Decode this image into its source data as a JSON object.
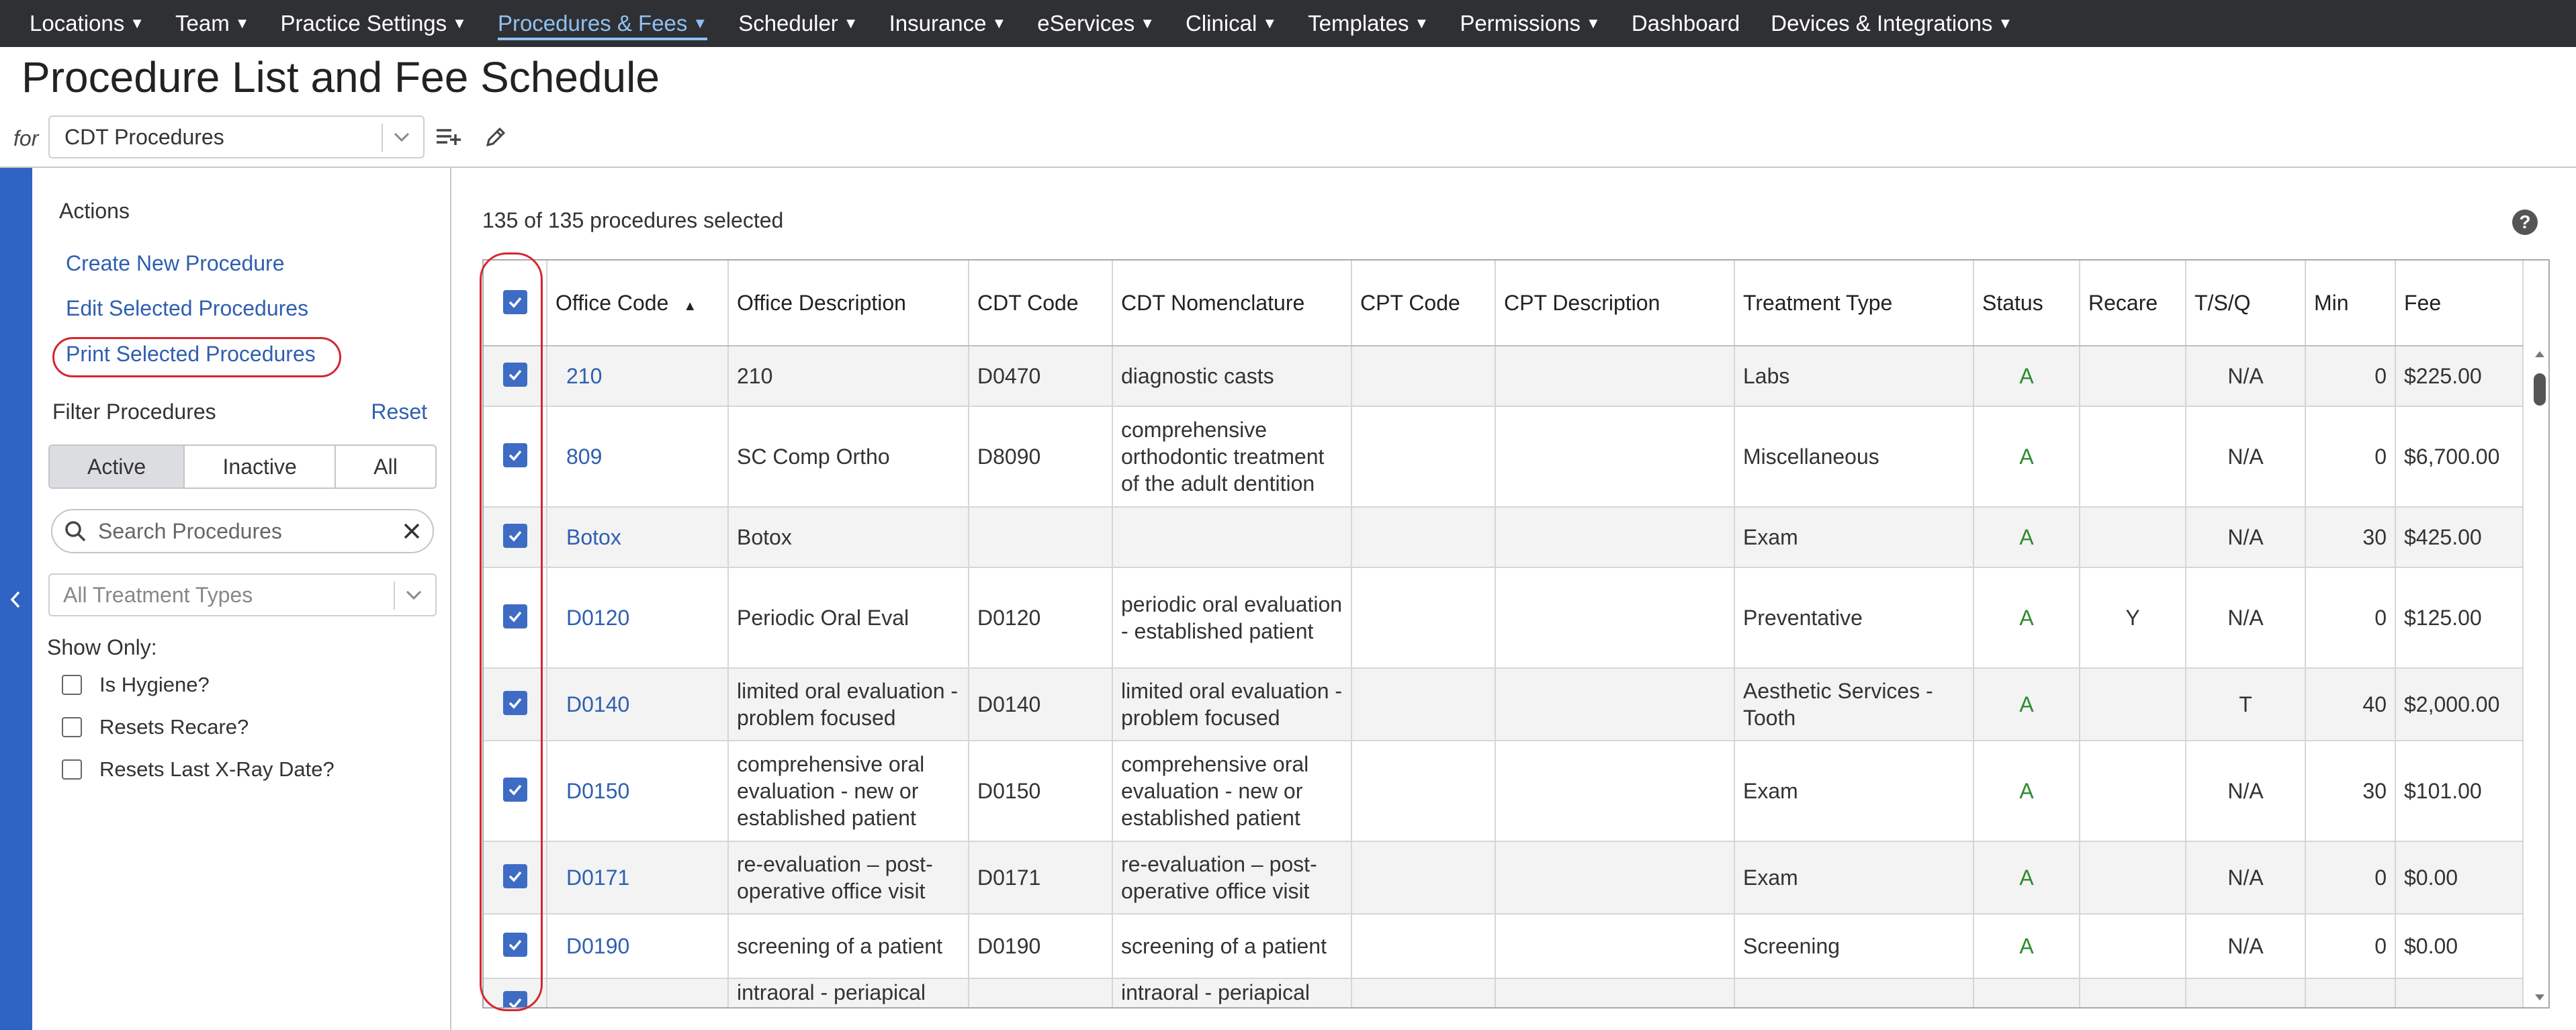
{
  "nav": {
    "items": [
      {
        "label": "Locations",
        "caret": true
      },
      {
        "label": "Team",
        "caret": true
      },
      {
        "label": "Practice Settings",
        "caret": true
      },
      {
        "label": "Procedures & Fees",
        "caret": true,
        "active": true
      },
      {
        "label": "Scheduler",
        "caret": true
      },
      {
        "label": "Insurance",
        "caret": true
      },
      {
        "label": "eServices",
        "caret": true
      },
      {
        "label": "Clinical",
        "caret": true
      },
      {
        "label": "Templates",
        "caret": true
      },
      {
        "label": "Permissions",
        "caret": true
      },
      {
        "label": "Dashboard",
        "caret": false
      },
      {
        "label": "Devices & Integrations",
        "caret": true
      }
    ]
  },
  "header": {
    "title": "Procedure List and Fee Schedule",
    "for_label": "for",
    "schedule_value": "CDT Procedures"
  },
  "sidebar": {
    "actions_heading": "Actions",
    "create_link": "Create New Procedure",
    "edit_link": "Edit Selected Procedures",
    "print_link": "Print Selected Procedures",
    "filter_heading": "Filter Procedures",
    "reset_link": "Reset",
    "status_filter": {
      "active": "Active",
      "inactive": "Inactive",
      "all": "All",
      "selected": "Active"
    },
    "search_placeholder": "Search Procedures",
    "treatment_type_placeholder": "All Treatment Types",
    "show_only_label": "Show Only:",
    "checkboxes": [
      "Is Hygiene?",
      "Resets Recare?",
      "Resets Last X-Ray Date?"
    ]
  },
  "main": {
    "selected_count_text": "135 of 135 procedures selected",
    "help_glyph": "?",
    "columns": [
      "Office Code",
      "Office Description",
      "CDT Code",
      "CDT Nomenclature",
      "CPT Code",
      "CPT Description",
      "Treatment Type",
      "Status",
      "Recare",
      "T/S/Q",
      "Min",
      "Fee"
    ],
    "rows": [
      {
        "code": "210",
        "desc": "210",
        "cdt": "D0470",
        "nom": "diagnostic casts",
        "cpt": "",
        "cpt_desc": "",
        "type": "Labs",
        "status": "A",
        "recare": "",
        "tsq": "N/A",
        "min": "0",
        "fee": "$225.00"
      },
      {
        "code": "809",
        "desc": "SC Comp Ortho",
        "cdt": "D8090",
        "nom": "comprehensive orthodontic treatment of the adult dentition",
        "cpt": "",
        "cpt_desc": "",
        "type": "Miscellaneous",
        "status": "A",
        "recare": "",
        "tsq": "N/A",
        "min": "0",
        "fee": "$6,700.00"
      },
      {
        "code": "Botox",
        "desc": "Botox",
        "cdt": "",
        "nom": "",
        "cpt": "",
        "cpt_desc": "",
        "type": "Exam",
        "status": "A",
        "recare": "",
        "tsq": "N/A",
        "min": "30",
        "fee": "$425.00"
      },
      {
        "code": "D0120",
        "desc": "Periodic Oral Eval",
        "cdt": "D0120",
        "nom": "periodic oral evaluation - established patient",
        "cpt": "",
        "cpt_desc": "",
        "type": "Preventative",
        "status": "A",
        "recare": "Y",
        "tsq": "N/A",
        "min": "0",
        "fee": "$125.00"
      },
      {
        "code": "D0140",
        "desc": "limited oral evaluation - problem focused",
        "cdt": "D0140",
        "nom": "limited oral evaluation - problem focused",
        "cpt": "",
        "cpt_desc": "",
        "type": "Aesthetic Services - Tooth",
        "status": "A",
        "recare": "",
        "tsq": "T",
        "min": "40",
        "fee": "$2,000.00"
      },
      {
        "code": "D0150",
        "desc": "comprehensive oral evaluation - new or established patient",
        "cdt": "D0150",
        "nom": "comprehensive oral evaluation - new or established patient",
        "cpt": "",
        "cpt_desc": "",
        "type": "Exam",
        "status": "A",
        "recare": "",
        "tsq": "N/A",
        "min": "30",
        "fee": "$101.00"
      },
      {
        "code": "D0171",
        "desc": "re-evaluation – post-operative office visit",
        "cdt": "D0171",
        "nom": "re-evaluation – post-operative office visit",
        "cpt": "",
        "cpt_desc": "",
        "type": "Exam",
        "status": "A",
        "recare": "",
        "tsq": "N/A",
        "min": "0",
        "fee": "$0.00"
      },
      {
        "code": "D0190",
        "desc": "screening of a patient",
        "cdt": "D0190",
        "nom": "screening of a patient",
        "cpt": "",
        "cpt_desc": "",
        "type": "Screening",
        "status": "A",
        "recare": "",
        "tsq": "N/A",
        "min": "0",
        "fee": "$0.00"
      },
      {
        "code": "",
        "desc": "intraoral - periapical",
        "cdt": "",
        "nom": "intraoral - periapical",
        "cpt": "",
        "cpt_desc": "",
        "type": "",
        "status": "",
        "recare": "",
        "tsq": "",
        "min": "",
        "fee": ""
      }
    ]
  },
  "colors": {
    "nav_bg": "#2f3033",
    "nav_active": "#8fc0f2",
    "link": "#2f5fb0",
    "checkbox": "#3e6cc4",
    "status_active": "#2e8b2e",
    "annotation": "#d4262f",
    "collapse_strip": "#2f64c4"
  }
}
